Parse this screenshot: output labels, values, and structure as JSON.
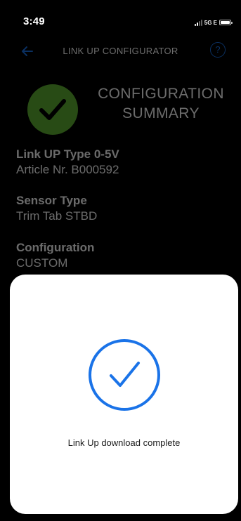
{
  "status_bar": {
    "time": "3:49",
    "network": "5G E"
  },
  "nav": {
    "title": "LINK UP CONFIGURATOR",
    "back_icon": "arrow-left-icon",
    "help_icon": "question-circle-icon",
    "help_glyph": "?"
  },
  "summary": {
    "title_line1": "CONFIGURATION",
    "title_line2": "SUMMARY",
    "icon": "check-circle-icon"
  },
  "details": [
    {
      "label": "Link UP Type 0-5V",
      "value": "Article Nr. B000592"
    },
    {
      "label": "Sensor Type",
      "value": "Trim Tab STBD"
    },
    {
      "label": "Configuration",
      "value": "CUSTOM"
    }
  ],
  "modal": {
    "message": "Link Up download complete",
    "icon": "check-circle-outline-icon"
  },
  "colors": {
    "background": "#000000",
    "accent_blue": "#1a73e8",
    "success_green": "#5fb232",
    "modal_background": "#ffffff"
  }
}
